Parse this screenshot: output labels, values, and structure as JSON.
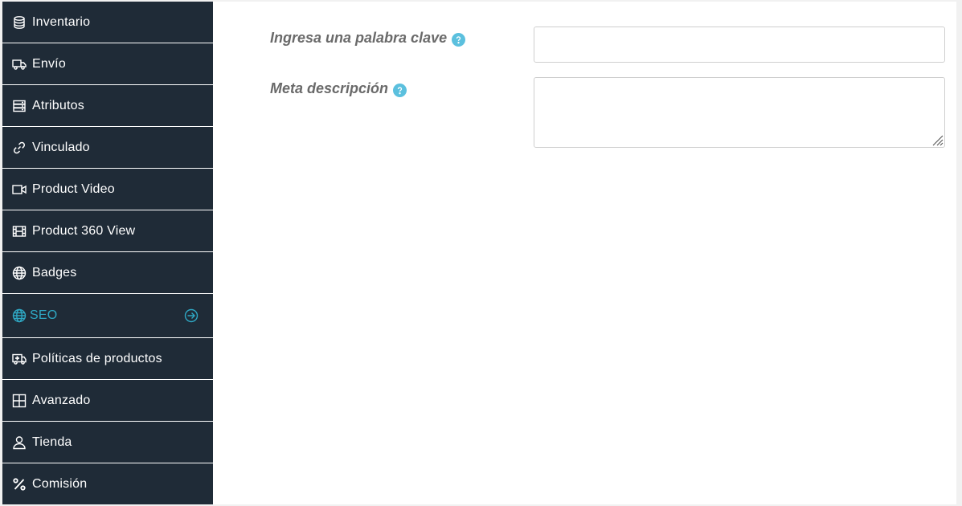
{
  "sidebar": {
    "items": [
      {
        "label": "Inventario",
        "icon": "database-icon"
      },
      {
        "label": "Envío",
        "icon": "truck-icon"
      },
      {
        "label": "Atributos",
        "icon": "server-icon"
      },
      {
        "label": "Vinculado",
        "icon": "link-icon"
      },
      {
        "label": "Product Video",
        "icon": "video-icon"
      },
      {
        "label": "Product 360 View",
        "icon": "film-icon"
      },
      {
        "label": "Badges",
        "icon": "globe-icon"
      },
      {
        "label": "SEO",
        "icon": "globe-icon",
        "active": true,
        "arrow": "arrow-right-circle-icon"
      },
      {
        "label": "Políticas de productos",
        "icon": "ambulance-icon"
      },
      {
        "label": "Avanzado",
        "icon": "grid-icon"
      },
      {
        "label": "Tienda",
        "icon": "user-icon"
      },
      {
        "label": "Comisión",
        "icon": "percent-icon"
      }
    ]
  },
  "form": {
    "keyword_label": "Ingresa una palabra clave",
    "keyword_value": "",
    "meta_label": "Meta descripción",
    "meta_value": ""
  },
  "colors": {
    "sidebar_bg": "#1f2b37",
    "accent": "#2fa8c4",
    "help_icon": "#5bc0de",
    "label_text": "#6a6a6a"
  }
}
